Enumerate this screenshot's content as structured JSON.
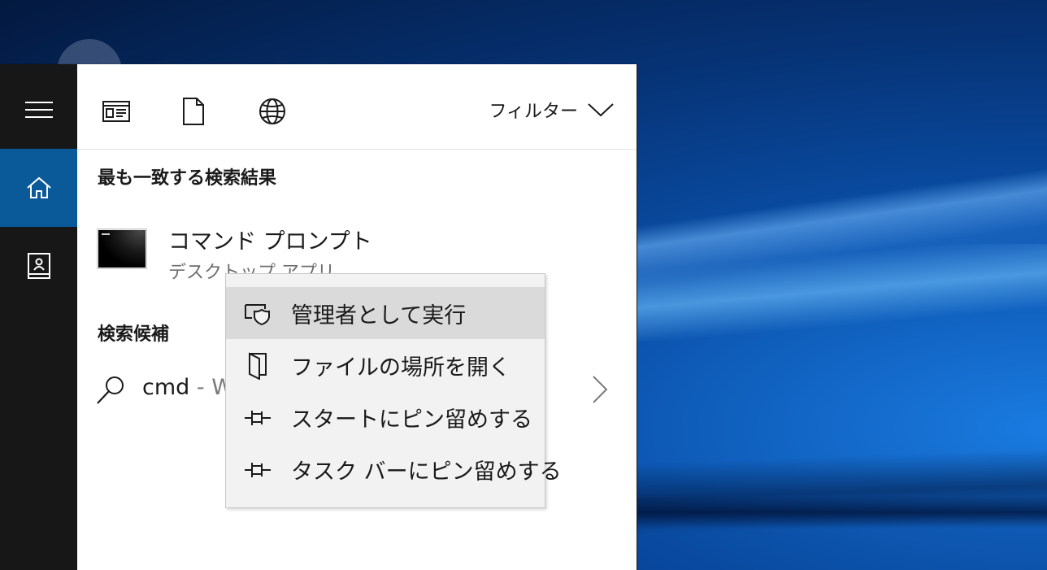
{
  "filter_bar": {
    "icons": [
      "apps-icon",
      "document-icon",
      "web-icon"
    ],
    "filter_label": "フィルター"
  },
  "rail": {
    "items": [
      "hamburger-menu-icon",
      "home-icon",
      "notebook-icon"
    ],
    "accent": "#0a5a99"
  },
  "best_match": {
    "heading": "最も一致する検索結果",
    "app_name": "コマンド プロンプト",
    "app_type": "デスクトップ アプリ"
  },
  "suggestions": {
    "heading": "検索候補",
    "query": "cmd",
    "suffix": " - W"
  },
  "context_menu": {
    "items": [
      {
        "label": "管理者として実行",
        "icon": "shield-icon"
      },
      {
        "label": "ファイルの場所を開く",
        "icon": "folder-open-icon"
      },
      {
        "label": "スタートにピン留めする",
        "icon": "pin-icon"
      },
      {
        "label": "タスク バーにピン留めする",
        "icon": "pin-icon"
      }
    ]
  }
}
